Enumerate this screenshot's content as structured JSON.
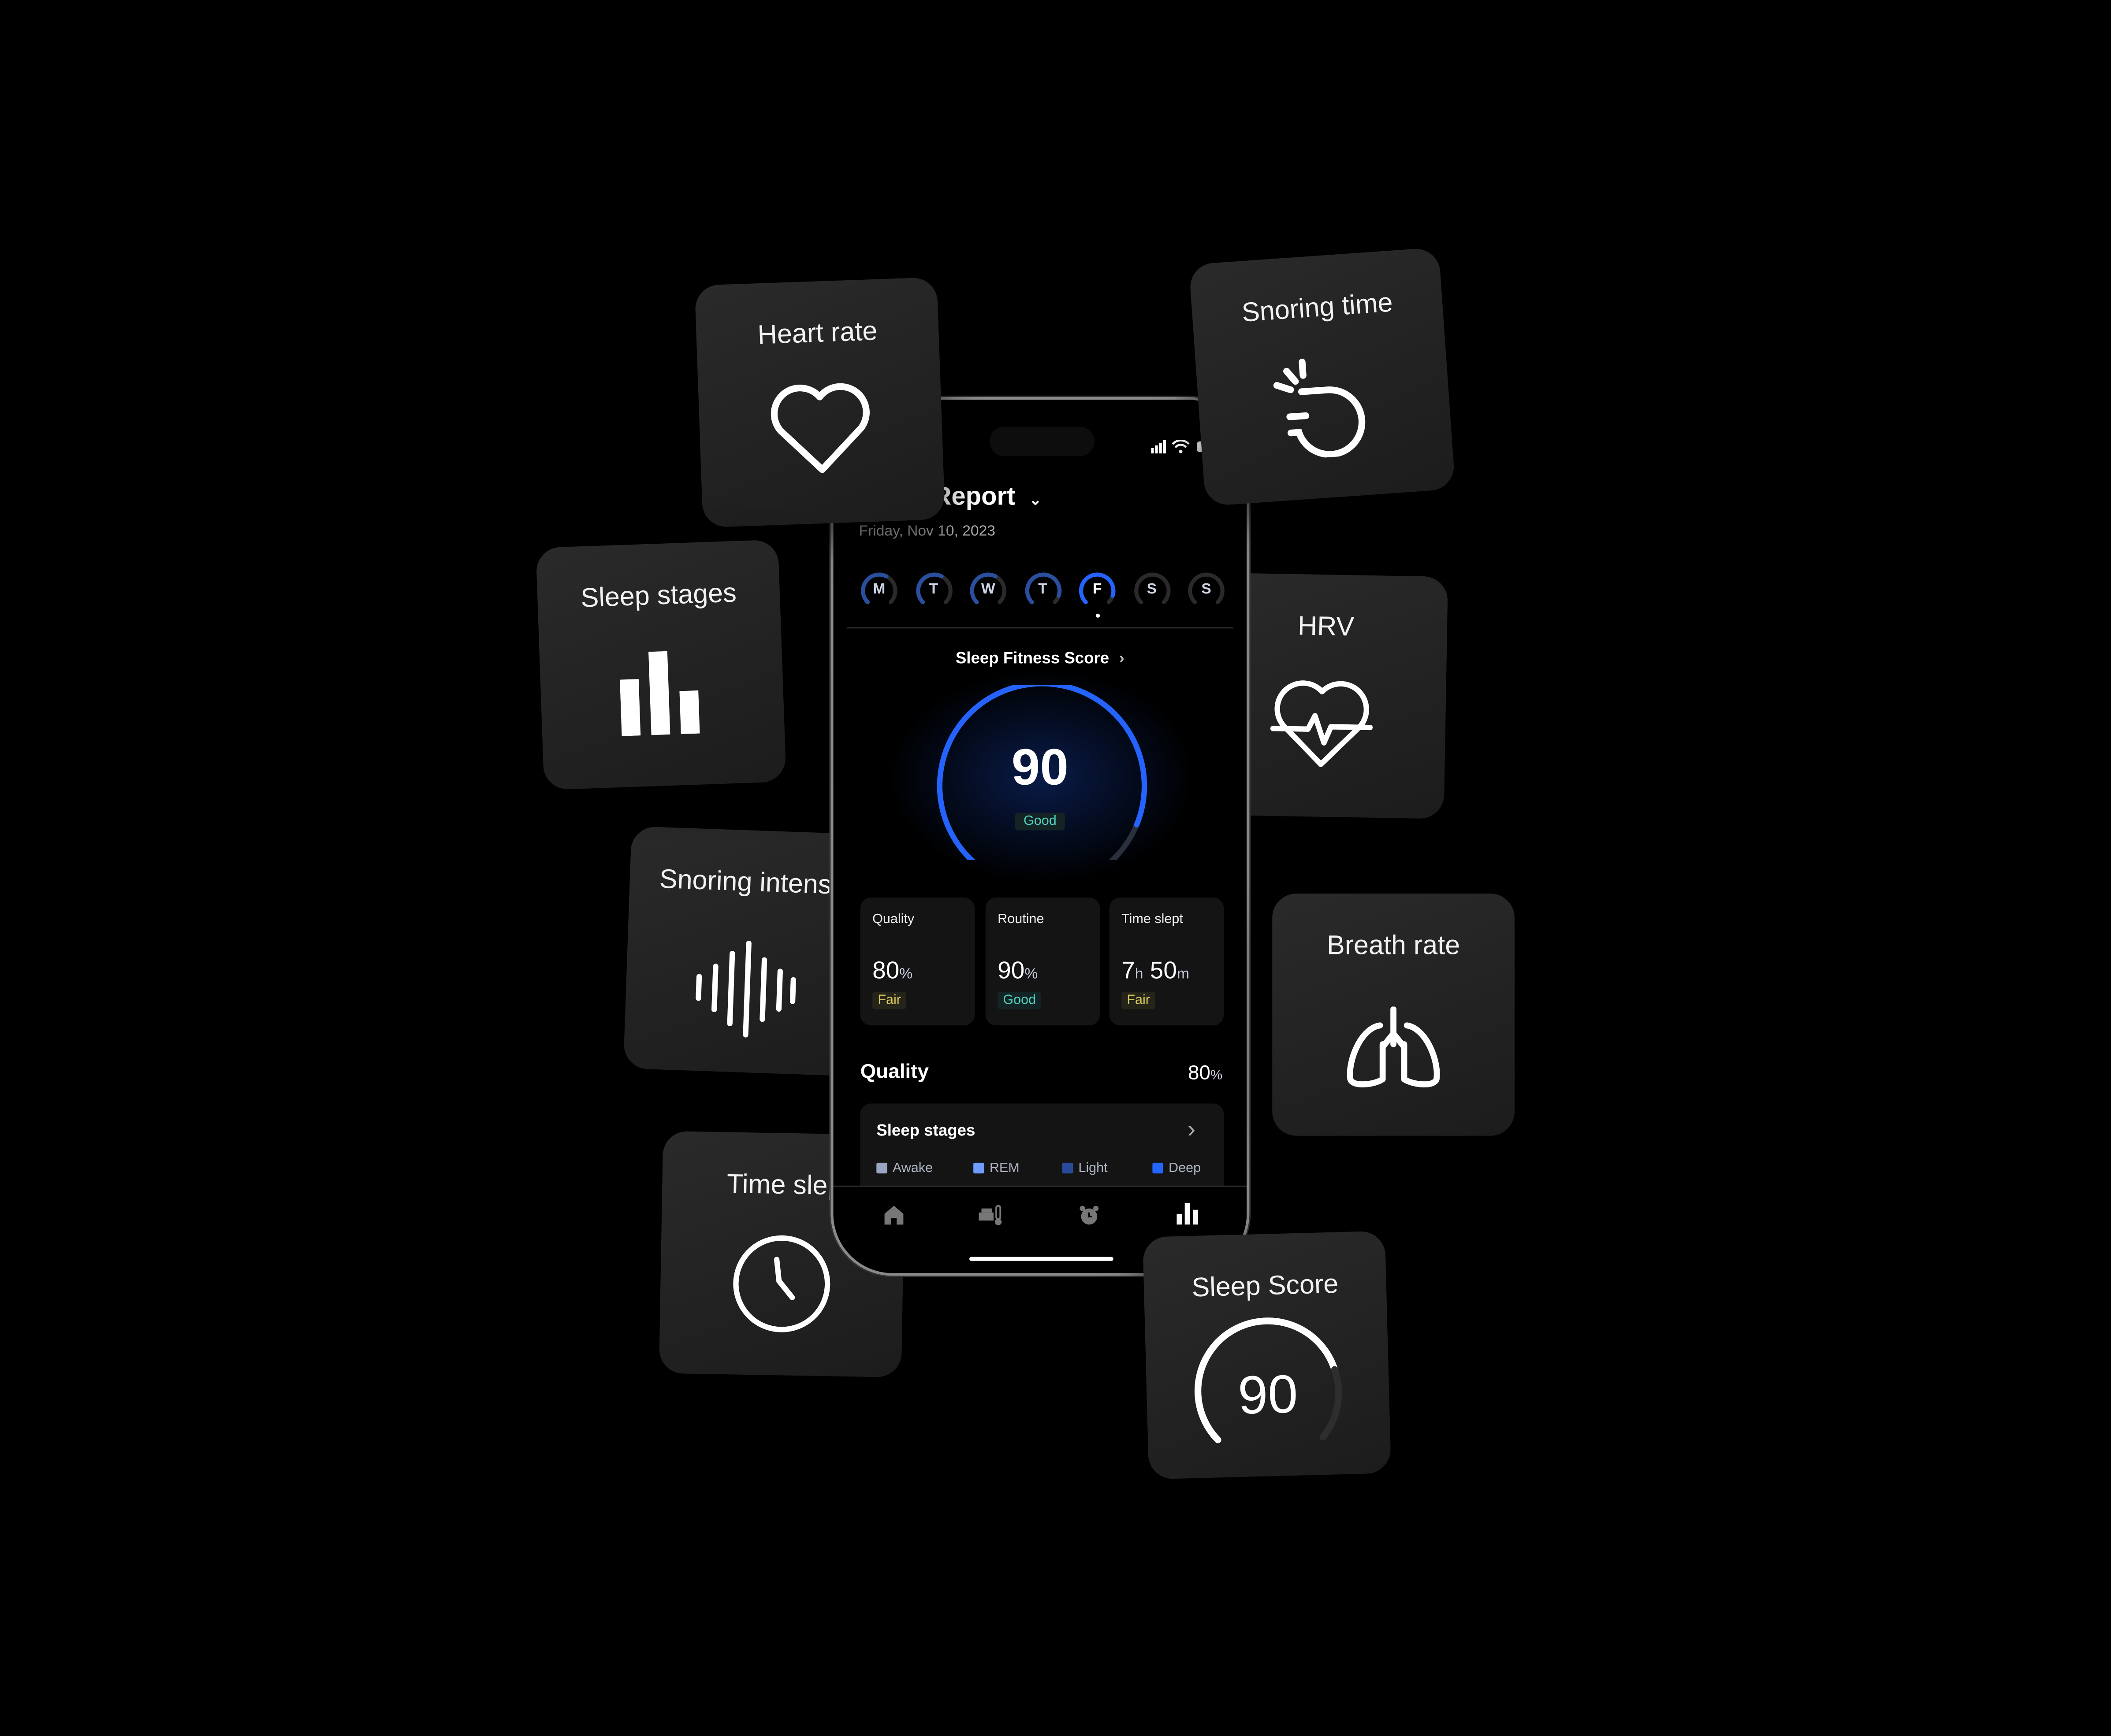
{
  "cards": {
    "heart_rate": "Heart rate",
    "snoring_time": "Snoring time",
    "sleep_stages": "Sleep stages",
    "hrv": "HRV",
    "snoring_intensity": "Snoring intensity",
    "breath_rate": "Breath rate",
    "time_slept": "Time slept",
    "sleep_score": "Sleep Score",
    "sleep_score_value": "90"
  },
  "phone": {
    "title": "Sleep Report",
    "date": "Friday, Nov 10, 2023",
    "days": [
      {
        "label": "M",
        "progress": 0.6
      },
      {
        "label": "T",
        "progress": 0.6
      },
      {
        "label": "W",
        "progress": 0.6
      },
      {
        "label": "T",
        "progress": 0.9
      },
      {
        "label": "F",
        "progress": 0.9,
        "selected": true
      },
      {
        "label": "S",
        "progress": 0
      },
      {
        "label": "S",
        "progress": 0
      }
    ],
    "score_title": "Sleep Fitness Score",
    "score": "90",
    "score_progress": 0.9,
    "score_status": "Good",
    "metrics": [
      {
        "label": "Quality",
        "value": "80",
        "unit": "%",
        "status": "Fair"
      },
      {
        "label": "Routine",
        "value": "90",
        "unit": "%",
        "status": "Good"
      },
      {
        "label": "Time slept",
        "hours": "7",
        "h": "h",
        "minutes": "50",
        "m": "m",
        "status": "Fair"
      }
    ],
    "quality_heading": "Quality",
    "quality_value": "80",
    "quality_unit": "%",
    "stages_title": "Sleep stages",
    "legend": [
      {
        "label": "Awake",
        "color": "#9aa5c4"
      },
      {
        "label": "REM",
        "color": "#6f9cff"
      },
      {
        "label": "Light",
        "color": "#284a98"
      },
      {
        "label": "Deep",
        "color": "#2266ff"
      }
    ],
    "nav": [
      "home-icon",
      "bed-temperature-icon",
      "alarm-icon",
      "stats-icon"
    ],
    "accent": "#2563ff"
  }
}
